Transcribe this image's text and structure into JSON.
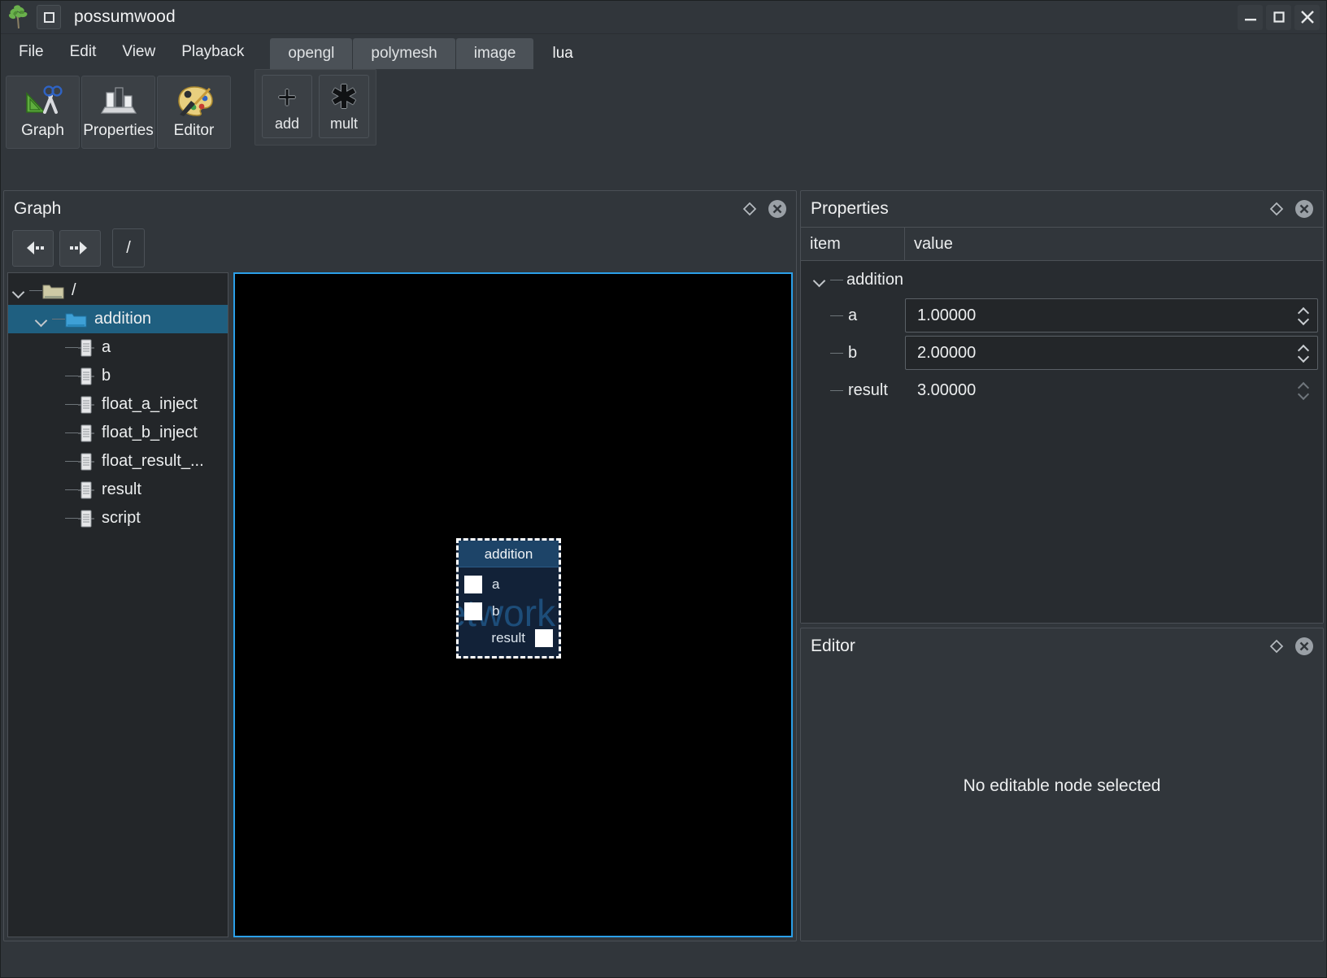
{
  "window": {
    "title": "possumwood",
    "icon": "tree-logo",
    "sys_menu_icon": "window-square-icon",
    "controls": [
      {
        "name": "minimize-button",
        "glyph": "minimize-icon"
      },
      {
        "name": "maximize-button",
        "glyph": "maximize-icon"
      },
      {
        "name": "close-button",
        "glyph": "close-icon"
      }
    ]
  },
  "menubar": {
    "items": [
      {
        "label": "File"
      },
      {
        "label": "Edit"
      },
      {
        "label": "View"
      },
      {
        "label": "Playback"
      }
    ]
  },
  "doctabs": {
    "tabs": [
      {
        "label": "opengl",
        "active": false
      },
      {
        "label": "polymesh",
        "active": false
      },
      {
        "label": "image",
        "active": false
      },
      {
        "label": "lua",
        "active": true
      }
    ]
  },
  "panel_buttons": [
    {
      "label": "Graph",
      "icon": "graph-icon"
    },
    {
      "label": "Properties",
      "icon": "properties-icon"
    },
    {
      "label": "Editor",
      "icon": "editor-palette-icon"
    }
  ],
  "node_toolbar": {
    "buttons": [
      {
        "label": "add",
        "glyph": "+",
        "icon": "plus-icon"
      },
      {
        "label": "mult",
        "glyph": "✱",
        "icon": "asterisk-icon"
      }
    ]
  },
  "graph_dock": {
    "title": "Graph",
    "float_icon": "diamond-icon",
    "close_icon": "close-circle-icon",
    "nav": {
      "back_icon": "arrow-back-icon",
      "forward_icon": "arrow-forward-icon",
      "path": "/"
    },
    "tree": [
      {
        "label": "/",
        "depth": 0,
        "type": "folder",
        "expanded": true,
        "selected": false
      },
      {
        "label": "addition",
        "depth": 1,
        "type": "folder",
        "expanded": true,
        "selected": true
      },
      {
        "label": "a",
        "depth": 2,
        "type": "node",
        "expanded": null,
        "selected": false
      },
      {
        "label": "b",
        "depth": 2,
        "type": "node",
        "expanded": null,
        "selected": false
      },
      {
        "label": "float_a_inject",
        "depth": 2,
        "type": "node",
        "expanded": null,
        "selected": false
      },
      {
        "label": "float_b_inject",
        "depth": 2,
        "type": "node",
        "expanded": null,
        "selected": false
      },
      {
        "label": "float_result_...",
        "depth": 2,
        "type": "node",
        "expanded": null,
        "selected": false
      },
      {
        "label": "result",
        "depth": 2,
        "type": "node",
        "expanded": null,
        "selected": false
      },
      {
        "label": "script",
        "depth": 2,
        "type": "node",
        "expanded": null,
        "selected": false
      }
    ],
    "canvas": {
      "watermark": "network",
      "node": {
        "title": "addition",
        "inputs": [
          {
            "label": "a"
          },
          {
            "label": "b"
          }
        ],
        "outputs": [
          {
            "label": "result"
          }
        ],
        "selected": true
      }
    }
  },
  "properties_dock": {
    "title": "Properties",
    "float_icon": "diamond-icon",
    "close_icon": "close-circle-icon",
    "columns": [
      "item",
      "value"
    ],
    "group": {
      "label": "addition",
      "expanded": true
    },
    "rows": [
      {
        "name": "a",
        "value": "1.00000",
        "editable": true
      },
      {
        "name": "b",
        "value": "2.00000",
        "editable": true
      },
      {
        "name": "result",
        "value": "3.00000",
        "editable": false
      }
    ]
  },
  "editor_dock": {
    "title": "Editor",
    "float_icon": "diamond-icon",
    "close_icon": "close-circle-icon",
    "empty_message": "No editable node selected"
  },
  "colors": {
    "window_bg": "#31363b",
    "panel_bg": "#232629",
    "canvas_bg": "#000000",
    "accent_focus": "#2b9fe8",
    "selection": "#1f5f80",
    "node_title": "#1d4468",
    "node_body": "#122238",
    "watermark": "#1d4d79"
  }
}
